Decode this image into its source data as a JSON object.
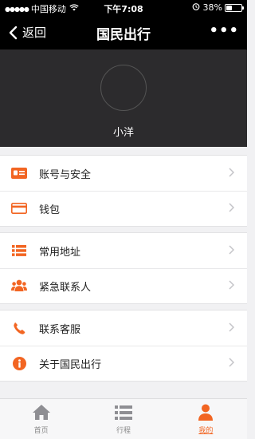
{
  "status_bar": {
    "signal_dots": "●●●●●",
    "carrier": "中国移动",
    "time": "下午7:08",
    "battery": "38%",
    "battery_level": 0.38,
    "wifi_icon": "wifi-icon",
    "alarm_icon": "alarm-icon"
  },
  "nav": {
    "back_label": "返回",
    "title": "国民出行",
    "more_label": "•••"
  },
  "profile": {
    "username": "小洋"
  },
  "menu_groups": [
    {
      "items": [
        {
          "label": "账号与安全",
          "icon": "id-card-icon"
        },
        {
          "label": "钱包",
          "icon": "wallet-card-icon"
        }
      ]
    },
    {
      "items": [
        {
          "label": "常用地址",
          "icon": "list-icon"
        },
        {
          "label": "紧急联系人",
          "icon": "contacts-icon"
        }
      ]
    },
    {
      "items": [
        {
          "label": "联系客服",
          "icon": "phone-icon"
        },
        {
          "label": "关于国民出行",
          "icon": "info-icon"
        }
      ]
    }
  ],
  "tabs": [
    {
      "label": "首页",
      "icon": "home-icon",
      "active": false
    },
    {
      "label": "行程",
      "icon": "list-icon",
      "active": false
    },
    {
      "label": "我的",
      "icon": "person-icon",
      "active": true
    }
  ],
  "colors": {
    "accent": "#f26522",
    "header_bg": "#000000",
    "profile_bg": "#2c2b2d",
    "page_bg": "#f1f1f3"
  }
}
